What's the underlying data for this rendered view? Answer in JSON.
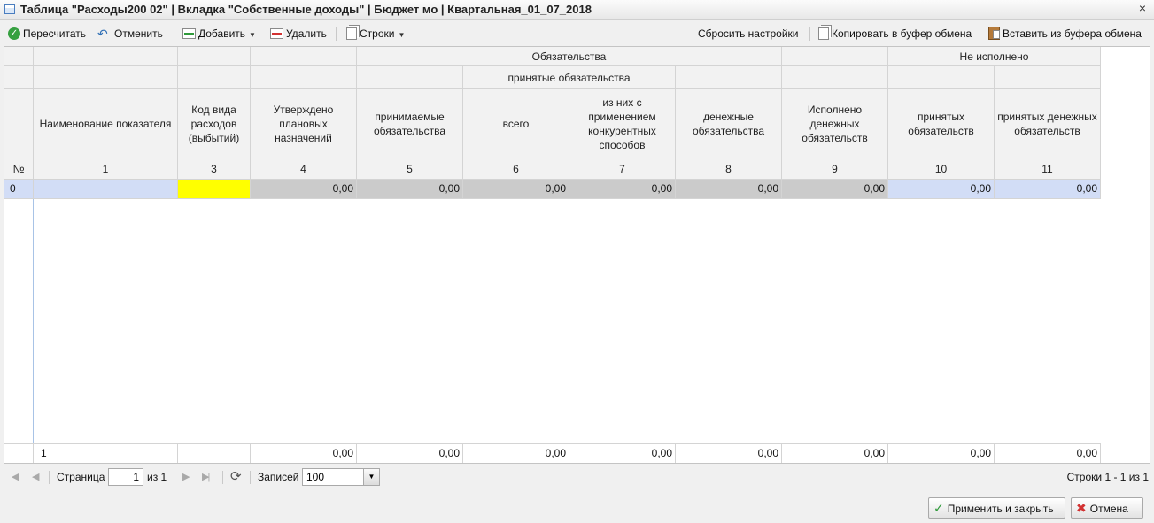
{
  "window": {
    "title": "Таблица \"Расходы200 02\" | Вкладка \"Собственные доходы\" | Бюджет мо | Квартальная_01_07_2018",
    "close_symbol": "×"
  },
  "toolbar": {
    "recalc": "Пересчитать",
    "cancel": "Отменить",
    "add": "Добавить",
    "delete": "Удалить",
    "rows": "Строки",
    "reset_settings": "Сбросить настройки",
    "copy_clipboard": "Копировать в буфер обмена",
    "paste_clipboard": "Вставить из буфера обмена"
  },
  "table": {
    "group_headers": {
      "obligations": "Обязательства",
      "accepted_obligations": "принятые обязательства",
      "not_executed": "Не исполнено"
    },
    "columns": [
      {
        "label": "Наименование показателя",
        "num": "1"
      },
      {
        "label": "Код вида расходов (выбытий)",
        "num": "3"
      },
      {
        "label": "Утверждено плановых назначений",
        "num": "4"
      },
      {
        "label": "принимаемые обязательства",
        "num": "5"
      },
      {
        "label": "всего",
        "num": "6"
      },
      {
        "label": "из них с применением конкурентных способов",
        "num": "7"
      },
      {
        "label": "денежные обязательства",
        "num": "8"
      },
      {
        "label": "Исполнено денежных обязательств",
        "num": "9"
      },
      {
        "label": "принятых обязательств",
        "num": "10"
      },
      {
        "label": "принятых денежных обязательств",
        "num": "11"
      }
    ],
    "row_number_header": "№",
    "rows": [
      {
        "n": "0",
        "name": "",
        "code": "",
        "values": [
          "0,00",
          "0,00",
          "0,00",
          "0,00",
          "0,00",
          "0,00",
          "0,00",
          "0,00"
        ]
      }
    ],
    "footer": {
      "count": "1",
      "values": [
        "0,00",
        "0,00",
        "0,00",
        "0,00",
        "0,00",
        "0,00",
        "0,00",
        "0,00"
      ]
    }
  },
  "pager": {
    "page_label": "Страница",
    "page_value": "1",
    "of_label": "из 1",
    "records_label": "Записей",
    "records_value": "100",
    "summary": "Строки 1 - 1 из 1"
  },
  "buttons": {
    "apply_close": "Применить и закрыть",
    "cancel": "Отмена"
  }
}
